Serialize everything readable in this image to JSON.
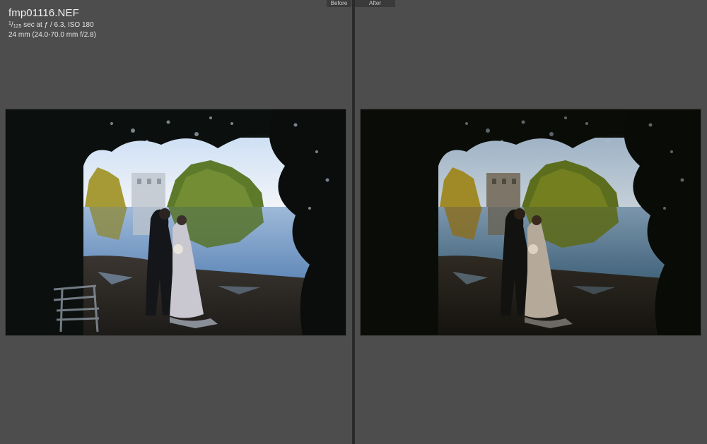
{
  "photo_info": {
    "filename": "fmp01116.NEF",
    "shutter_num": "1",
    "shutter_den": "125",
    "exposure_rest": " sec at ƒ / 6.3, ISO 180",
    "lens": "24 mm (24.0-70.0 mm f/2.8)"
  },
  "compare": {
    "before_label": "Before",
    "after_label": "After"
  },
  "colors": {
    "background": "#4d4d4d",
    "divider": "#2a2a2a",
    "label_bg": "#3a3a3a"
  },
  "images": {
    "before": {
      "description_icon": "wedding-photo-before"
    },
    "after": {
      "description_icon": "wedding-photo-after"
    }
  }
}
